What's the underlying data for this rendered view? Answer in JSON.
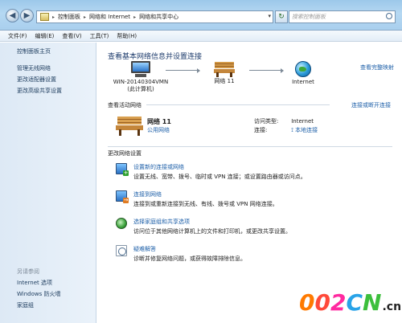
{
  "address_bar": {
    "crumbs": [
      "控制面板",
      "网络和 Internet",
      "网络和共享中心"
    ],
    "search_placeholder": "搜索控制面板"
  },
  "menu": [
    "文件(F)",
    "编辑(E)",
    "查看(V)",
    "工具(T)",
    "帮助(H)"
  ],
  "sidebar": {
    "items": [
      "控制面板主页",
      "管理无线网络",
      "更改适配器设置",
      "更改高级共享设置"
    ],
    "see_also_title": "另请参阅",
    "see_also": [
      "Internet 选项",
      "Windows 防火墙",
      "家庭组"
    ]
  },
  "main": {
    "heading": "查看基本网络信息并设置连接",
    "view_full_map": "查看完整映射",
    "map": {
      "computer_name": "WIN-20140304VMN",
      "computer_sub": "(此计算机)",
      "network_name": "网络  11",
      "internet": "Internet"
    },
    "active_networks_title": "查看活动网络",
    "connect_disconnect": "连接或断开连接",
    "network": {
      "name": "网络  11",
      "type": "公用网络",
      "access_label": "访问类型:",
      "access_value": "Internet",
      "connection_label": "连接:",
      "connection_value": "本地连接"
    },
    "change_settings_title": "更改网络设置",
    "tasks": [
      {
        "title": "设置新的连接或网络",
        "desc": "设置无线、宽带、拨号、临时或 VPN 连接；或设置路由器或访问点。",
        "icon": "network-setup-icon"
      },
      {
        "title": "连接到网络",
        "desc": "连接到或重新连接到无线、有线、拨号或 VPN 网络连接。",
        "icon": "connect-network-icon"
      },
      {
        "title": "选择家庭组和共享选项",
        "desc": "访问位于其他网络计算机上的文件和打印机，或更改共享设置。",
        "icon": "homegroup-icon"
      },
      {
        "title": "疑难解答",
        "desc": "诊断并修复网络问题，或获得故障排除信息。",
        "icon": "troubleshoot-icon"
      }
    ]
  },
  "watermark": {
    "brand": "002CN",
    "tld": ".cn"
  }
}
